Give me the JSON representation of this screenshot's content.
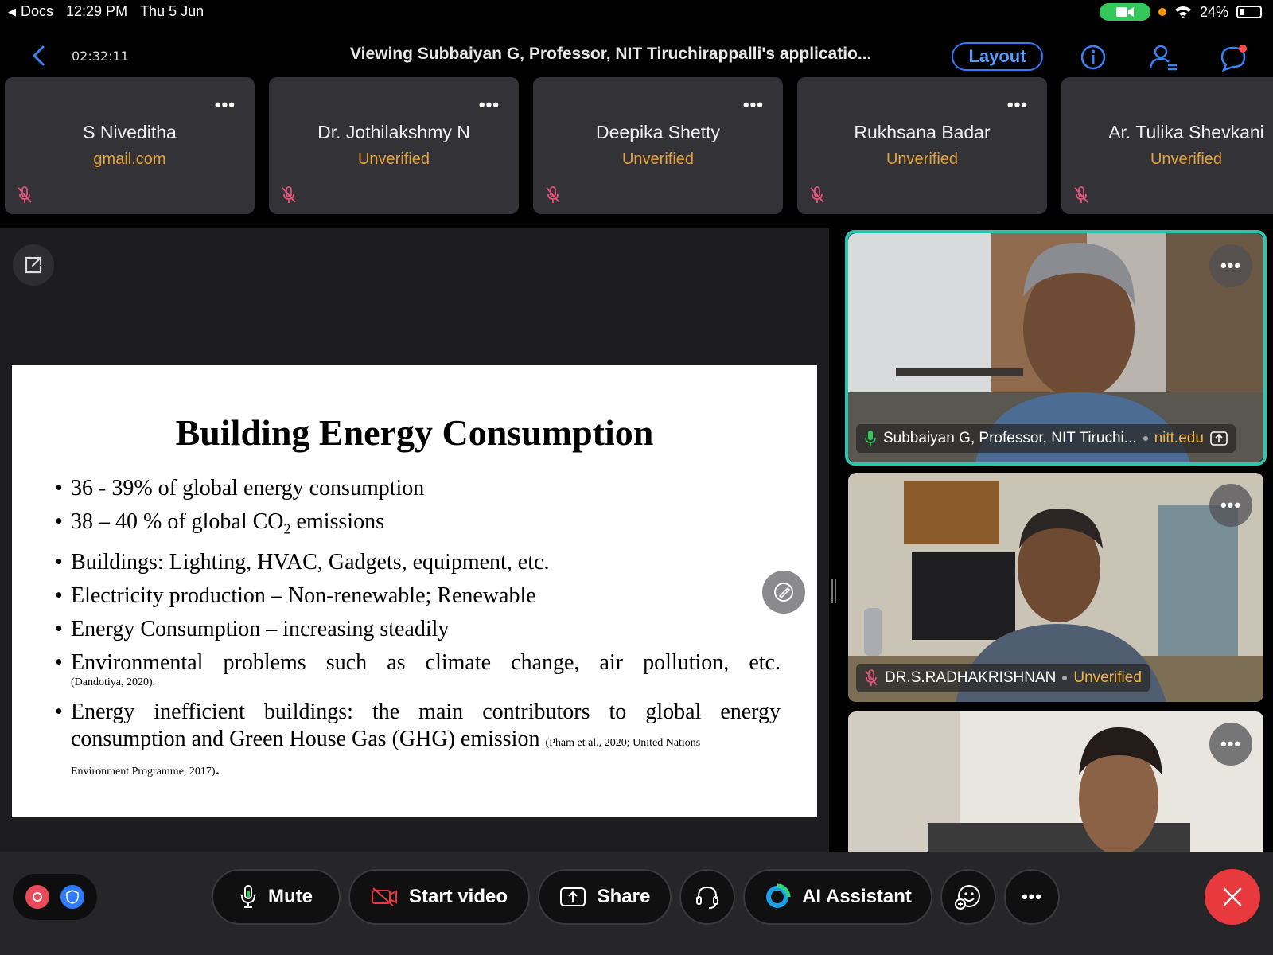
{
  "status_bar": {
    "back_app": "Docs",
    "time": "12:29 PM",
    "date": "Thu 5 Jun",
    "battery": "24%"
  },
  "header": {
    "timer": "02:32:11",
    "title": "Viewing Subbaiyan G, Professor, NIT Tiruchirappalli's applicatio...",
    "layout_label": "Layout"
  },
  "participants": [
    {
      "name": "S Niveditha",
      "status": "gmail.com"
    },
    {
      "name": "Dr. Jothilakshmy N",
      "status": "Unverified"
    },
    {
      "name": "Deepika Shetty",
      "status": "Unverified"
    },
    {
      "name": "Rukhsana Badar",
      "status": "Unverified"
    },
    {
      "name": "Ar. Tulika Shevkani",
      "status": "Unverified"
    }
  ],
  "slide": {
    "title": "Building Energy Consumption",
    "bullets": [
      "36 - 39% of global energy consumption",
      "38 – 40 % of global CO",
      "Buildings: Lighting, HVAC, Gadgets, equipment, etc.",
      "Electricity production – Non-renewable; Renewable",
      "Energy Consumption – increasing steadily",
      "Environmental problems such as climate change, air pollution, etc.",
      "Energy inefficient buildings: the main contributors to global energy consumption and Green House Gas (GHG) emission"
    ],
    "co2_subscript": "2",
    "co2_suffix": " emissions",
    "citation_env": "(Dandotiya, 2020).",
    "citation_energy_a": "(Pham et al., 2020; United Nations",
    "citation_energy_b": "Environment Programme, 2017)",
    "citation_energy_end": "."
  },
  "videos": [
    {
      "name": "Subbaiyan G, Professor, NIT Tiruchi...",
      "domain": "nitt.edu"
    },
    {
      "name": "DR.S.RADHAKRISHNAN",
      "domain": "Unverified"
    }
  ],
  "controls": {
    "mute": "Mute",
    "start_video": "Start video",
    "share": "Share",
    "ai_assistant": "AI Assistant"
  },
  "colors": {
    "accent_blue": "#2f7bff",
    "unverified_orange": "#e3a23e",
    "active_speaker": "#2dc4b0",
    "end_red": "#e8393f"
  }
}
